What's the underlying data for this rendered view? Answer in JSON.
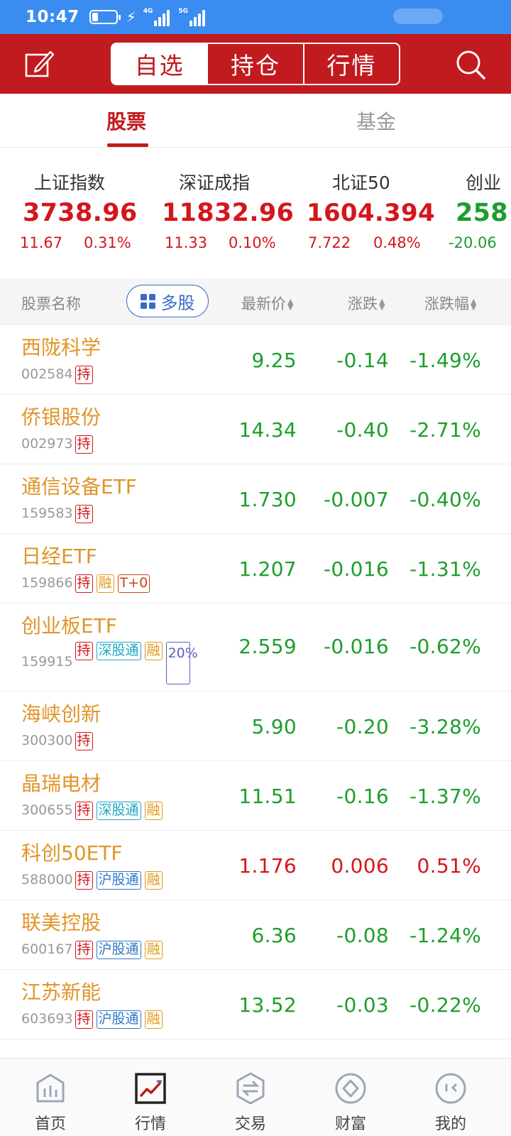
{
  "status": {
    "time": "10:47",
    "net_4g": "4G",
    "net_5g": "5G"
  },
  "header": {
    "tabs": [
      "自选",
      "持仓",
      "行情"
    ],
    "active_tab": 0
  },
  "subtabs": {
    "stocks": "股票",
    "funds": "基金"
  },
  "indices": [
    {
      "name": "上证指数",
      "price": "3738.96",
      "change": "11.67",
      "pct": "0.31%",
      "trend": "up"
    },
    {
      "name": "深证成指",
      "price": "11832.96",
      "change": "11.33",
      "pct": "0.10%",
      "trend": "up"
    },
    {
      "name": "北证50",
      "price": "1604.394",
      "change": "7.722",
      "pct": "0.48%",
      "trend": "up"
    },
    {
      "name": "创业",
      "price": "258",
      "change": "-20.06",
      "pct": "",
      "trend": "down"
    }
  ],
  "columns": {
    "name": "股票名称",
    "multi": "多股",
    "price": "最新价",
    "change": "涨跌",
    "pct": "涨跌幅"
  },
  "stocks": [
    {
      "name": "西陇科学",
      "code": "002584",
      "tags": [
        "持"
      ],
      "price": "9.25",
      "change": "-0.14",
      "pct": "-1.49%",
      "trend": "down"
    },
    {
      "name": "侨银股份",
      "code": "002973",
      "tags": [
        "持"
      ],
      "price": "14.34",
      "change": "-0.40",
      "pct": "-2.71%",
      "trend": "down"
    },
    {
      "name": "通信设备ETF",
      "code": "159583",
      "tags": [
        "持"
      ],
      "price": "1.730",
      "change": "-0.007",
      "pct": "-0.40%",
      "trend": "down"
    },
    {
      "name": "日经ETF",
      "code": "159866",
      "tags": [
        "持",
        "融",
        "T+0"
      ],
      "price": "1.207",
      "change": "-0.016",
      "pct": "-1.31%",
      "trend": "down"
    },
    {
      "name": "创业板ETF",
      "code": "159915",
      "tags": [
        "持",
        "深股通",
        "融",
        "20%"
      ],
      "price": "2.559",
      "change": "-0.016",
      "pct": "-0.62%",
      "trend": "down"
    },
    {
      "name": "海峡创新",
      "code": "300300",
      "tags": [
        "持"
      ],
      "price": "5.90",
      "change": "-0.20",
      "pct": "-3.28%",
      "trend": "down"
    },
    {
      "name": "晶瑞电材",
      "code": "300655",
      "tags": [
        "持",
        "深股通",
        "融"
      ],
      "price": "11.51",
      "change": "-0.16",
      "pct": "-1.37%",
      "trend": "down"
    },
    {
      "name": "科创50ETF",
      "code": "588000",
      "tags": [
        "持",
        "沪股通",
        "融"
      ],
      "price": "1.176",
      "change": "0.006",
      "pct": "0.51%",
      "trend": "up"
    },
    {
      "name": "联美控股",
      "code": "600167",
      "tags": [
        "持",
        "沪股通",
        "融"
      ],
      "price": "6.36",
      "change": "-0.08",
      "pct": "-1.24%",
      "trend": "down"
    },
    {
      "name": "江苏新能",
      "code": "603693",
      "tags": [
        "持",
        "沪股通",
        "融"
      ],
      "price": "13.52",
      "change": "-0.03",
      "pct": "-0.22%",
      "trend": "down"
    }
  ],
  "nav": [
    {
      "label": "首页",
      "icon": "home-chart-icon"
    },
    {
      "label": "行情",
      "icon": "market-trend-icon"
    },
    {
      "label": "交易",
      "icon": "trade-exchange-icon"
    },
    {
      "label": "财富",
      "icon": "wealth-diamond-icon"
    },
    {
      "label": "我的",
      "icon": "profile-face-icon"
    }
  ],
  "colors": {
    "brand": "#c11a1f",
    "up": "#d4161c",
    "down": "#1c9e2b",
    "stock_name": "#e0952a",
    "status_bar": "#3b8cf0"
  }
}
